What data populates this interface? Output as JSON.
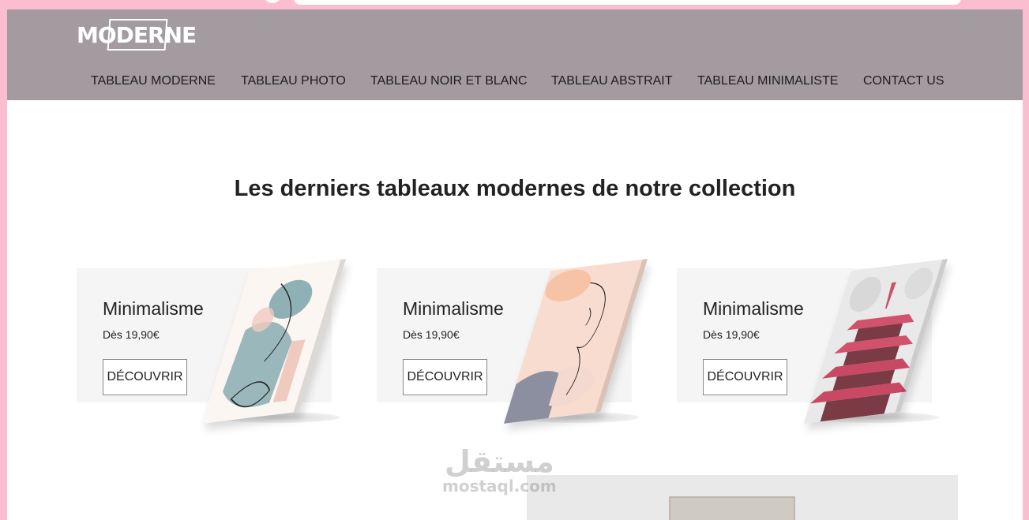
{
  "site": {
    "logo_text": "MODERNE"
  },
  "nav": {
    "items": [
      {
        "label": "TABLEAU MODERNE"
      },
      {
        "label": "TABLEAU PHOTO"
      },
      {
        "label": "TABLEAU NOIR ET BLANC"
      },
      {
        "label": "TABLEAU ABSTRAIT"
      },
      {
        "label": "TABLEAU MINIMALISTE"
      },
      {
        "label": "CONTACT US"
      }
    ]
  },
  "main": {
    "title": "Les derniers tableaux modernes de notre collection",
    "products": [
      {
        "name": "Minimalisme",
        "price": "Dès 19,90€",
        "button": "DÉCOUVRIR"
      },
      {
        "name": "Minimalisme",
        "price": "Dès 19,90€",
        "button": "DÉCOUVRIR"
      },
      {
        "name": "Minimalisme",
        "price": "Dès 19,90€",
        "button": "DÉCOUVRIR"
      }
    ]
  },
  "watermark": {
    "arabic": "مستقل",
    "latin": "mostaql.com"
  },
  "colors": {
    "header_bg": "#a39b9f",
    "page_frame": "#fbbdd0",
    "card_bg": "#f5f5f5"
  }
}
